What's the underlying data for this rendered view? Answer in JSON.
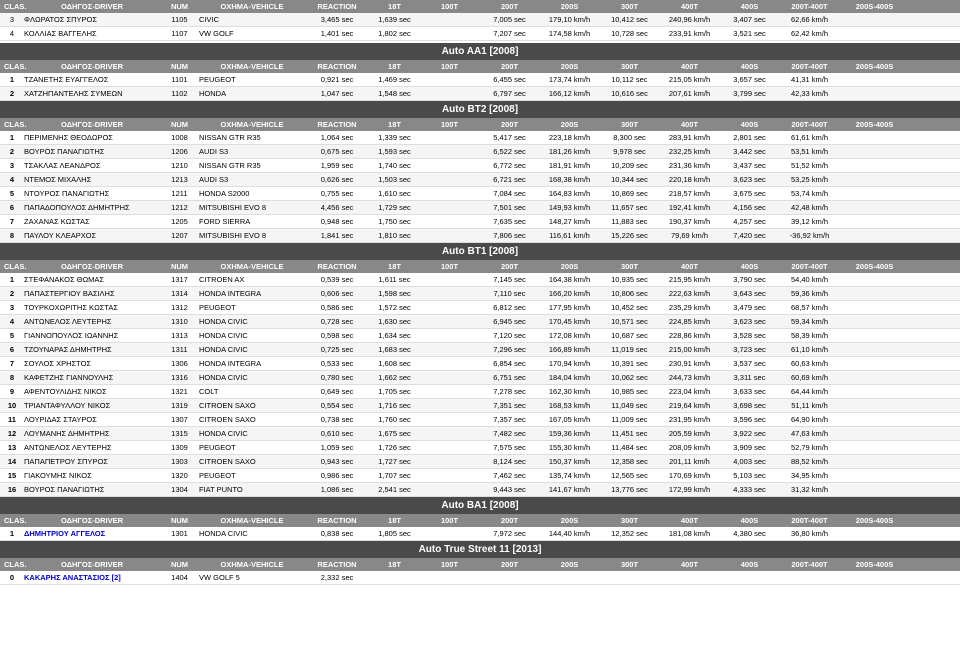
{
  "colors": {
    "section_bg": "#4a4a4a",
    "col_header_bg": "#888888",
    "accent_blue": "#0000cc",
    "row_even": "#f5f5f5",
    "row_odd": "#ffffff"
  },
  "col_headers": [
    "CLAS.",
    "ΟΔΗΓΟΣ-DRIVER",
    "NUM",
    "ΟΧΗΜΑ-VEHICLE",
    "REACTION",
    "18T",
    "100T",
    "200T",
    "200S",
    "300T",
    "400T",
    "400S",
    "200T-400T",
    "200S-400S"
  ],
  "top_section": {
    "rows": [
      [
        "3",
        "ΦΛΩΡΑΤΟΣ ΣΠΥΡΟΣ",
        "1105",
        "CIVIC",
        "3,465 sec",
        "1,639 sec",
        "",
        "7,005 sec",
        "179,10 km/h",
        "10,412 sec",
        "240,96 km/h",
        "3,407 sec",
        "62,66 km/h"
      ],
      [
        "4",
        "ΚΟΛΛΙΑΣ ΒΑΓΓΕΛΗΣ",
        "1107",
        "VW GOLF",
        "1,401 sec",
        "1,802 sec",
        "",
        "7,207 sec",
        "174,58 km/h",
        "10,728 sec",
        "233,91 km/h",
        "3,521 sec",
        "62,42 km/h"
      ]
    ]
  },
  "auto_aa1": {
    "title": "Auto AA1 [2008]",
    "rows": [
      [
        "1",
        "ΤΖΑΝΕΤΗΣ ΕΥΑΓΓΕΛΟΣ",
        "1101",
        "PEUGEOT",
        "0,921 sec",
        "1,469 sec",
        "",
        "6,455 sec",
        "173,74 km/h",
        "10,112 sec",
        "215,05 km/h",
        "3,657 sec",
        "41,31 km/h"
      ],
      [
        "2",
        "ΧΑΤΖΗΠΑΝΤΕΛΗΣ ΣΥΜΕΩΝ",
        "1102",
        "HONDA",
        "1,047 sec",
        "1,548 sec",
        "",
        "6,797 sec",
        "166,12 km/h",
        "10,616 sec",
        "207,61 km/h",
        "3,799 sec",
        "42,33 km/h"
      ]
    ]
  },
  "auto_bt2": {
    "title": "Auto BT2 [2008]",
    "rows": [
      [
        "1",
        "ΠΕΡΙΜΕΝΗΣ ΘΕΟΔΩΡΟΣ",
        "1008",
        "NISSAN GTR R35",
        "1,064 sec",
        "1,339 sec",
        "",
        "5,417 sec",
        "223,18 km/h",
        "8,300 sec",
        "283,91 km/h",
        "2,801 sec",
        "61,61 km/h"
      ],
      [
        "2",
        "ΒΟΥΡΟΣ ΠΑΝΑΓΙΩΤΗΣ",
        "1206",
        "AUDI S3",
        "0,675 sec",
        "1,593 sec",
        "",
        "6,522 sec",
        "181,26 km/h",
        "9,978 sec",
        "232,25 km/h",
        "3,442 sec",
        "53,51 km/h"
      ],
      [
        "3",
        "ΤΣΑΚΛΑΣ ΛΕΑΝΔΡΟΣ",
        "1210",
        "NISSAN GTR R35",
        "1,959 sec",
        "1,740 sec",
        "",
        "6,772 sec",
        "181,91 km/h",
        "10,209 sec",
        "231,36 km/h",
        "3,437 sec",
        "51,52 km/h"
      ],
      [
        "4",
        "ΝΤΕΜΟΣ ΜΙΧΑΛΗΣ",
        "1213",
        "AUDI S3",
        "0,626 sec",
        "1,503 sec",
        "",
        "6,721 sec",
        "168,38 km/h",
        "10,344 sec",
        "220,18 km/h",
        "3,623 sec",
        "53,25 km/h"
      ],
      [
        "5",
        "ΝΤΟΥΡΟΣ ΠΑΝΑΓΙΩΤΗΣ",
        "1211",
        "HONDA S2000",
        "0,755 sec",
        "1,610 sec",
        "",
        "7,084 sec",
        "164,83 km/h",
        "10,869 sec",
        "218,57 km/h",
        "3,675 sec",
        "53,74 km/h"
      ],
      [
        "6",
        "ΠΑΠΑΔΟΠΟΥΛΟΣ ΔΗΜΗΤΡΗΣ",
        "1212",
        "MITSUBISHI EVO 8",
        "4,456 sec",
        "1,729 sec",
        "",
        "7,501 sec",
        "149,93 km/h",
        "11,657 sec",
        "192,41 km/h",
        "4,156 sec",
        "42,48 km/h"
      ],
      [
        "7",
        "ΖΑΧΑΝΑΣ ΚΩΣΤΑΣ",
        "1205",
        "FORD SIERRA",
        "0,948 sec",
        "1,750 sec",
        "",
        "7,635 sec",
        "148,27 km/h",
        "11,883 sec",
        "190,37 km/h",
        "4,257 sec",
        "39,12 km/h"
      ],
      [
        "8",
        "ΠΑΥΛΟΥ ΚΛΕΑΡΧΟΣ",
        "1207",
        "MITSUBISHI EVO 8",
        "1,841 sec",
        "1,810 sec",
        "",
        "7,806 sec",
        "116,61 km/h",
        "15,226 sec",
        "79,69 km/h",
        "7,420 sec",
        "-36,92 km/h"
      ]
    ]
  },
  "auto_bt1": {
    "title": "Auto BT1 [2008]",
    "rows": [
      [
        "1",
        "ΣΤΕΦΑΝΑΚΟΣ ΘΩΜΑΣ",
        "1317",
        "CITROEN AX",
        "0,539 sec",
        "1,611 sec",
        "",
        "7,145 sec",
        "164,38 km/h",
        "10,935 sec",
        "215,95 km/h",
        "3,790 sec",
        "54,40 km/h"
      ],
      [
        "2",
        "ΠΑΠΑΣΤΕΡΓΙΟΥ ΒΑΣΙΛΗΣ",
        "1314",
        "HONDA INTEGRA",
        "0,606 sec",
        "1,598 sec",
        "",
        "7,110 sec",
        "166,20 km/h",
        "10,806 sec",
        "222,63 km/h",
        "3,643 sec",
        "59,36 km/h"
      ],
      [
        "3",
        "ΤΟΥΡΚΟΧΩΡΙΤΗΣ ΚΩΣΤΑΣ",
        "1312",
        "PEUGEOT",
        "0,586 sec",
        "1,572 sec",
        "",
        "6,812 sec",
        "177,95 km/h",
        "10,452 sec",
        "235,29 km/h",
        "3,479 sec",
        "68,57 km/h"
      ],
      [
        "4",
        "ΑΝΤΩΝΕΛΟΣ ΛΕΥΤΕΡΗΣ",
        "1310",
        "HONDA CIVIC",
        "0,728 sec",
        "1,630 sec",
        "",
        "6,945 sec",
        "170,45 km/h",
        "10,571 sec",
        "224,85 km/h",
        "3,623 sec",
        "59,34 km/h"
      ],
      [
        "5",
        "ΓΙΑΝΝΟΠΟΥΛΟΣ ΙΩΑΝΝΗΣ",
        "1313",
        "HONDA CIVIC",
        "0,598 sec",
        "1,634 sec",
        "",
        "7,120 sec",
        "172,08 km/h",
        "10,687 sec",
        "228,86 km/h",
        "3,528 sec",
        "58,39 km/h"
      ],
      [
        "6",
        "ΤΖΟΥΝΑΡΑΣ ΔΗΜΗΤΡΗΣ",
        "1311",
        "HONDA CIVIC",
        "0,725 sec",
        "1,683 sec",
        "",
        "7,296 sec",
        "166,89 km/h",
        "11,019 sec",
        "215,00 km/h",
        "3,723 sec",
        "61,10 km/h"
      ],
      [
        "7",
        "ΣΟΥΛΟΣ ΧΡΗΣΤΟΣ",
        "1306",
        "HONDA INTEGRA",
        "0,533 sec",
        "1,608 sec",
        "",
        "6,854 sec",
        "170,94 km/h",
        "10,391 sec",
        "230,91 km/h",
        "3,537 sec",
        "60,63 km/h"
      ],
      [
        "8",
        "ΚΑΦΕΤΖΗΣ ΓΙΑΝΝΟΥΛΗΣ",
        "1316",
        "HONDA CIVIC",
        "0,780 sec",
        "1,662 sec",
        "",
        "6,751 sec",
        "184,04 km/h",
        "10,062 sec",
        "244,73 km/h",
        "3,311 sec",
        "60,69 km/h"
      ],
      [
        "9",
        "ΑΦΕΝΤΟΥΛΙΔΗΣ ΝΙΚΟΣ",
        "1321",
        "COLT",
        "0,649 sec",
        "1,705 sec",
        "",
        "7,278 sec",
        "162,30 km/h",
        "10,985 sec",
        "223,04 km/h",
        "3,633 sec",
        "64,44 km/h"
      ],
      [
        "10",
        "ΤΡΙΑΝΤΑΦΥΛΛΟΥ ΝΙΚΟΣ",
        "1319",
        "CITROEN SAXO",
        "0,554 sec",
        "1,716 sec",
        "",
        "7,351 sec",
        "168,53 km/h",
        "11,049 sec",
        "219,64 km/h",
        "3,698 sec",
        "51,11 km/h"
      ],
      [
        "11",
        "ΛΟΥΡΙΔΑΣ ΣΤΑΥΡΟΣ",
        "1307",
        "CITROEN SAXO",
        "0,738 sec",
        "1,760 sec",
        "",
        "7,357 sec",
        "167,05 km/h",
        "11,009 sec",
        "231,95 km/h",
        "3,596 sec",
        "64,90 km/h"
      ],
      [
        "12",
        "ΛΟΥΜΑΝΗΣ ΔΗΜΗΤΡΗΣ",
        "1315",
        "HONDA CIVIC",
        "0,610 sec",
        "1,675 sec",
        "",
        "7,482 sec",
        "159,36 km/h",
        "11,451 sec",
        "205,59 km/h",
        "3,922 sec",
        "47,63 km/h"
      ],
      [
        "13",
        "ΑΝΤΩΝΕΛΟΣ ΛΕΥΤΕΡΗΣ",
        "1309",
        "PEUGEOT",
        "1,059 sec",
        "1,726 sec",
        "",
        "7,575 sec",
        "155,30 km/h",
        "11,484 sec",
        "208,09 km/h",
        "3,909 sec",
        "52,79 km/h"
      ],
      [
        "14",
        "ΠΑΠΑΠΕΤΡΟΥ ΣΠΥΡΟΣ",
        "1303",
        "CITROEN SAXO",
        "0,943 sec",
        "1,727 sec",
        "",
        "8,124 sec",
        "150,37 km/h",
        "12,358 sec",
        "201,11 km/h",
        "4,003 sec",
        "88,52 km/h"
      ],
      [
        "15",
        "ΓΙΑΚΟΥΜΗΣ ΝΙΚΟΣ",
        "1320",
        "PEUGEOT",
        "0,986 sec",
        "1,707 sec",
        "",
        "7,462 sec",
        "135,74 km/h",
        "12,565 sec",
        "170,69 km/h",
        "5,103 sec",
        "34,95 km/h"
      ],
      [
        "16",
        "ΒΟΥΡΟΣ ΠΑΝΑΓΙΩΤΗΣ",
        "1304",
        "FIAT PUNTO",
        "1,086 sec",
        "2,541 sec",
        "",
        "9,443 sec",
        "141,67 km/h",
        "13,776 sec",
        "172,99 km/h",
        "4,333 sec",
        "31,32 km/h"
      ]
    ]
  },
  "auto_ba1": {
    "title": "Auto BA1 [2008]",
    "rows": [
      [
        "1",
        "ΔΗΜΗΤΡΙΟΥ ΑΓΓΕΛΟΣ",
        "1301",
        "HONDA CIVIC",
        "0,838 sec",
        "1,805 sec",
        "",
        "7,972 sec",
        "144,40 km/h",
        "12,352 sec",
        "181,08 km/h",
        "4,380 sec",
        "36,80 km/h"
      ]
    ]
  },
  "auto_true_street": {
    "title": "Auto True Street 11 [2013]",
    "rows": [
      [
        "0",
        "ΚΑΚΑΡΗΣ ΑΝΑΣΤΑΣΙΟΣ [2]",
        "1404",
        "VW GOLF 5",
        "2,332 sec",
        "",
        "",
        "",
        "",
        "",
        "",
        "",
        "",
        ""
      ]
    ]
  }
}
